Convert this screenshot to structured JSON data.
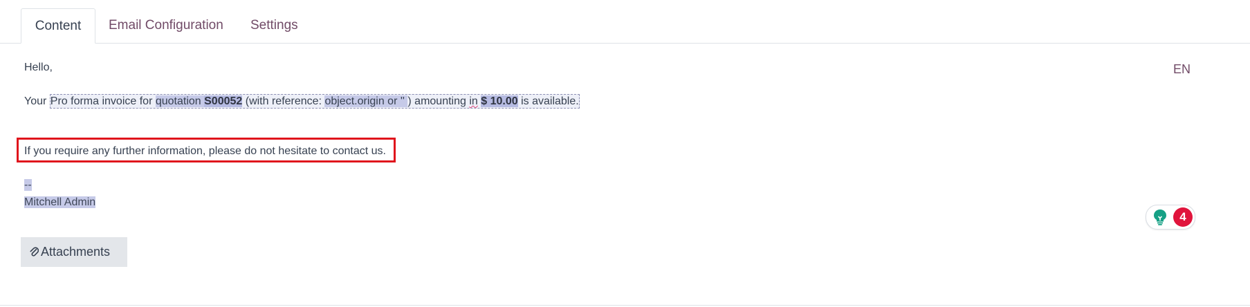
{
  "tabs": {
    "content": "Content",
    "email_configuration": "Email Configuration",
    "settings": "Settings"
  },
  "body": {
    "greeting": "Hello,",
    "invoice_line": {
      "your": "Your ",
      "pro_forma": "Pro forma invoice for ",
      "quotation_word": "quotation ",
      "quotation_number": "S00052",
      "with_reference": " (with reference: ",
      "origin_expr": "object.origin or '' ",
      "close_paren": ") amounting ",
      "in_word": "in",
      "space": " ",
      "amount": "$ 10.00",
      "is_available": " is available."
    },
    "help_line": "If you require any further information, please do not hesitate to contact us.",
    "signature_dash": "--",
    "signature_name": "Mitchell Admin"
  },
  "language": "EN",
  "grammar_badge": "4",
  "attachments_label": "Attachments",
  "colors": {
    "tab_link": "#714b67",
    "highlight_box": "#e0141c",
    "badge": "#e0143c",
    "bulb": "#16a085"
  },
  "icons": {
    "bulb": "lightbulb-icon",
    "attach": "paperclip-icon"
  }
}
